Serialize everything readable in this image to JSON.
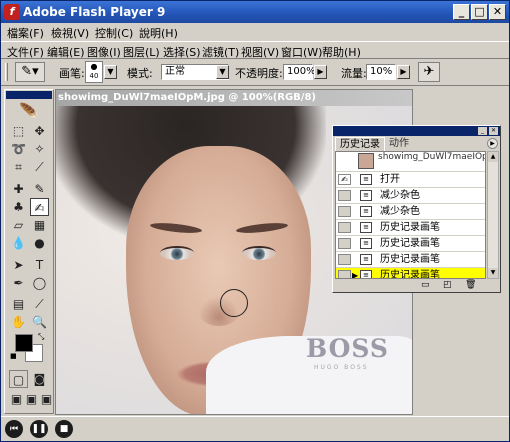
{
  "window": {
    "title": "Adobe Flash Player 9",
    "controls": [
      "_",
      "□",
      "✕"
    ]
  },
  "player_menu": [
    {
      "label": "檔案(F)"
    },
    {
      "label": "檢視(V)"
    },
    {
      "label": "控制(C)"
    },
    {
      "label": "說明(H)"
    }
  ],
  "ps_menu": [
    {
      "label": "文件(F)"
    },
    {
      "label": "编辑(E)"
    },
    {
      "label": "图像(I)"
    },
    {
      "label": "图层(L)"
    },
    {
      "label": "选择(S)"
    },
    {
      "label": "滤镜(T)"
    },
    {
      "label": "视图(V)"
    },
    {
      "label": "窗口(W)"
    },
    {
      "label": "帮助(H)"
    }
  ],
  "options": {
    "brush_label": "画笔:",
    "brush_size": "40",
    "mode_label": "模式:",
    "mode_value": "正常",
    "opacity_label": "不透明度:",
    "opacity_value": "100%",
    "flow_label": "流量:",
    "flow_value": "10%"
  },
  "document": {
    "title": "showimg_DuWl7maeIOpM.jpg @ 100%(RGB/8)",
    "watermark_big": "BOSS",
    "watermark_small": "HUGO BOSS"
  },
  "history_panel": {
    "tab_history": "历史记录",
    "tab_actions": "动作",
    "snapshot_label": "showimg_DuWl7maeIOpM...",
    "items": [
      {
        "label": "打开"
      },
      {
        "label": "减少杂色"
      },
      {
        "label": "减少杂色"
      },
      {
        "label": "历史记录画笔"
      },
      {
        "label": "历史记录画笔"
      },
      {
        "label": "历史记录画笔"
      },
      {
        "label": "历史记录画笔"
      }
    ],
    "active_index": 6,
    "highlight_color": "#ffff00"
  },
  "colors": {
    "titlebar": "#2456b8",
    "chrome": "#d4d0c8",
    "foreground_swatch": "#000000",
    "background_swatch": "#ffffff"
  },
  "player_controls": [
    "back-icon",
    "pause-icon",
    "stop-icon"
  ]
}
